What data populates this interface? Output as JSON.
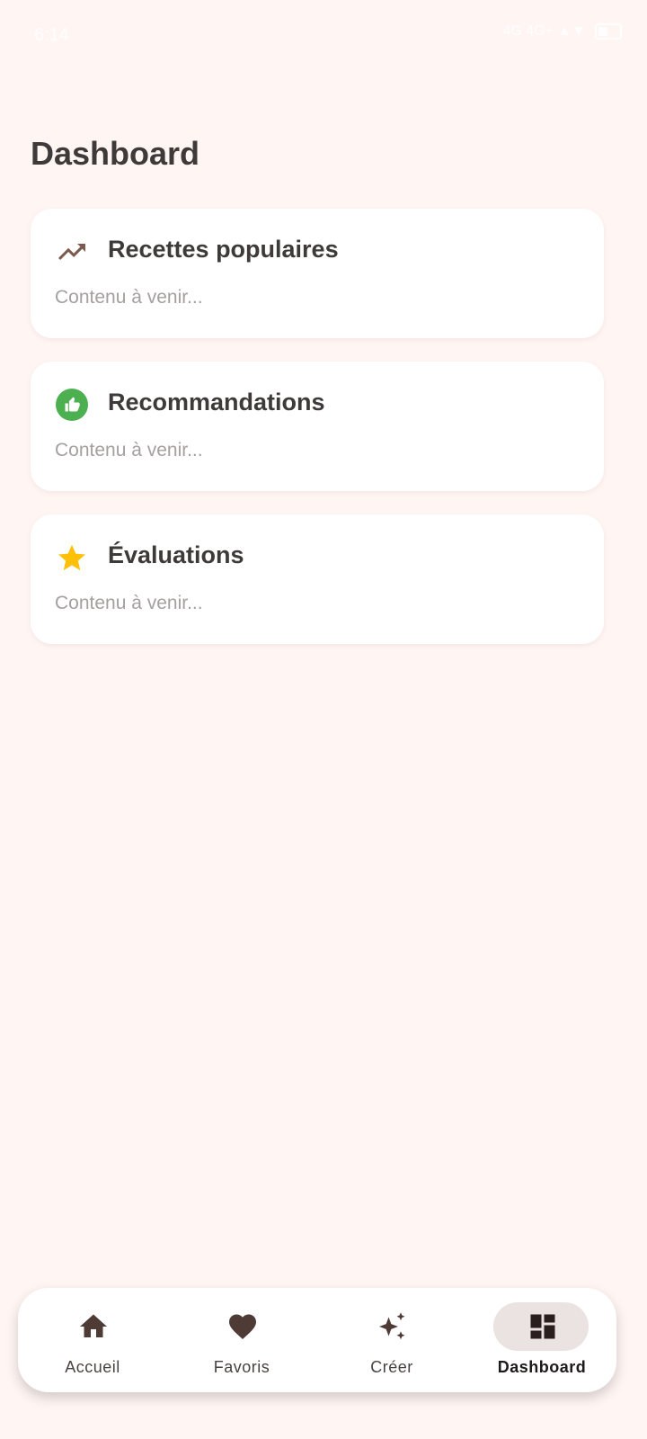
{
  "status_bar": {
    "time": "6:14",
    "indicators": "4G  4G+  ▲▼"
  },
  "page": {
    "title": "Dashboard"
  },
  "cards": [
    {
      "icon": "trending-up-icon",
      "title": "Recettes populaires",
      "subtitle": "Contenu à venir..."
    },
    {
      "icon": "thumb-up-icon",
      "title": "Recommandations",
      "subtitle": "Contenu à venir..."
    },
    {
      "icon": "star-icon",
      "title": "Évaluations",
      "subtitle": "Contenu à venir..."
    }
  ],
  "bottom_nav": {
    "items": [
      {
        "label": "Accueil",
        "icon": "home-icon",
        "active": false
      },
      {
        "label": "Favoris",
        "icon": "heart-icon",
        "active": false
      },
      {
        "label": "Créer",
        "icon": "sparkle-icon",
        "active": false
      },
      {
        "label": "Dashboard",
        "icon": "dashboard-icon",
        "active": true
      }
    ]
  },
  "colors": {
    "background": "#FFF5F3",
    "card": "#FFFFFF",
    "trend_icon": "#7D5A50",
    "thumb_icon": "#4CAF50",
    "star_icon": "#FFC107",
    "nav_icon": "#4E3B36",
    "active_pill": "#EBE3E1"
  }
}
